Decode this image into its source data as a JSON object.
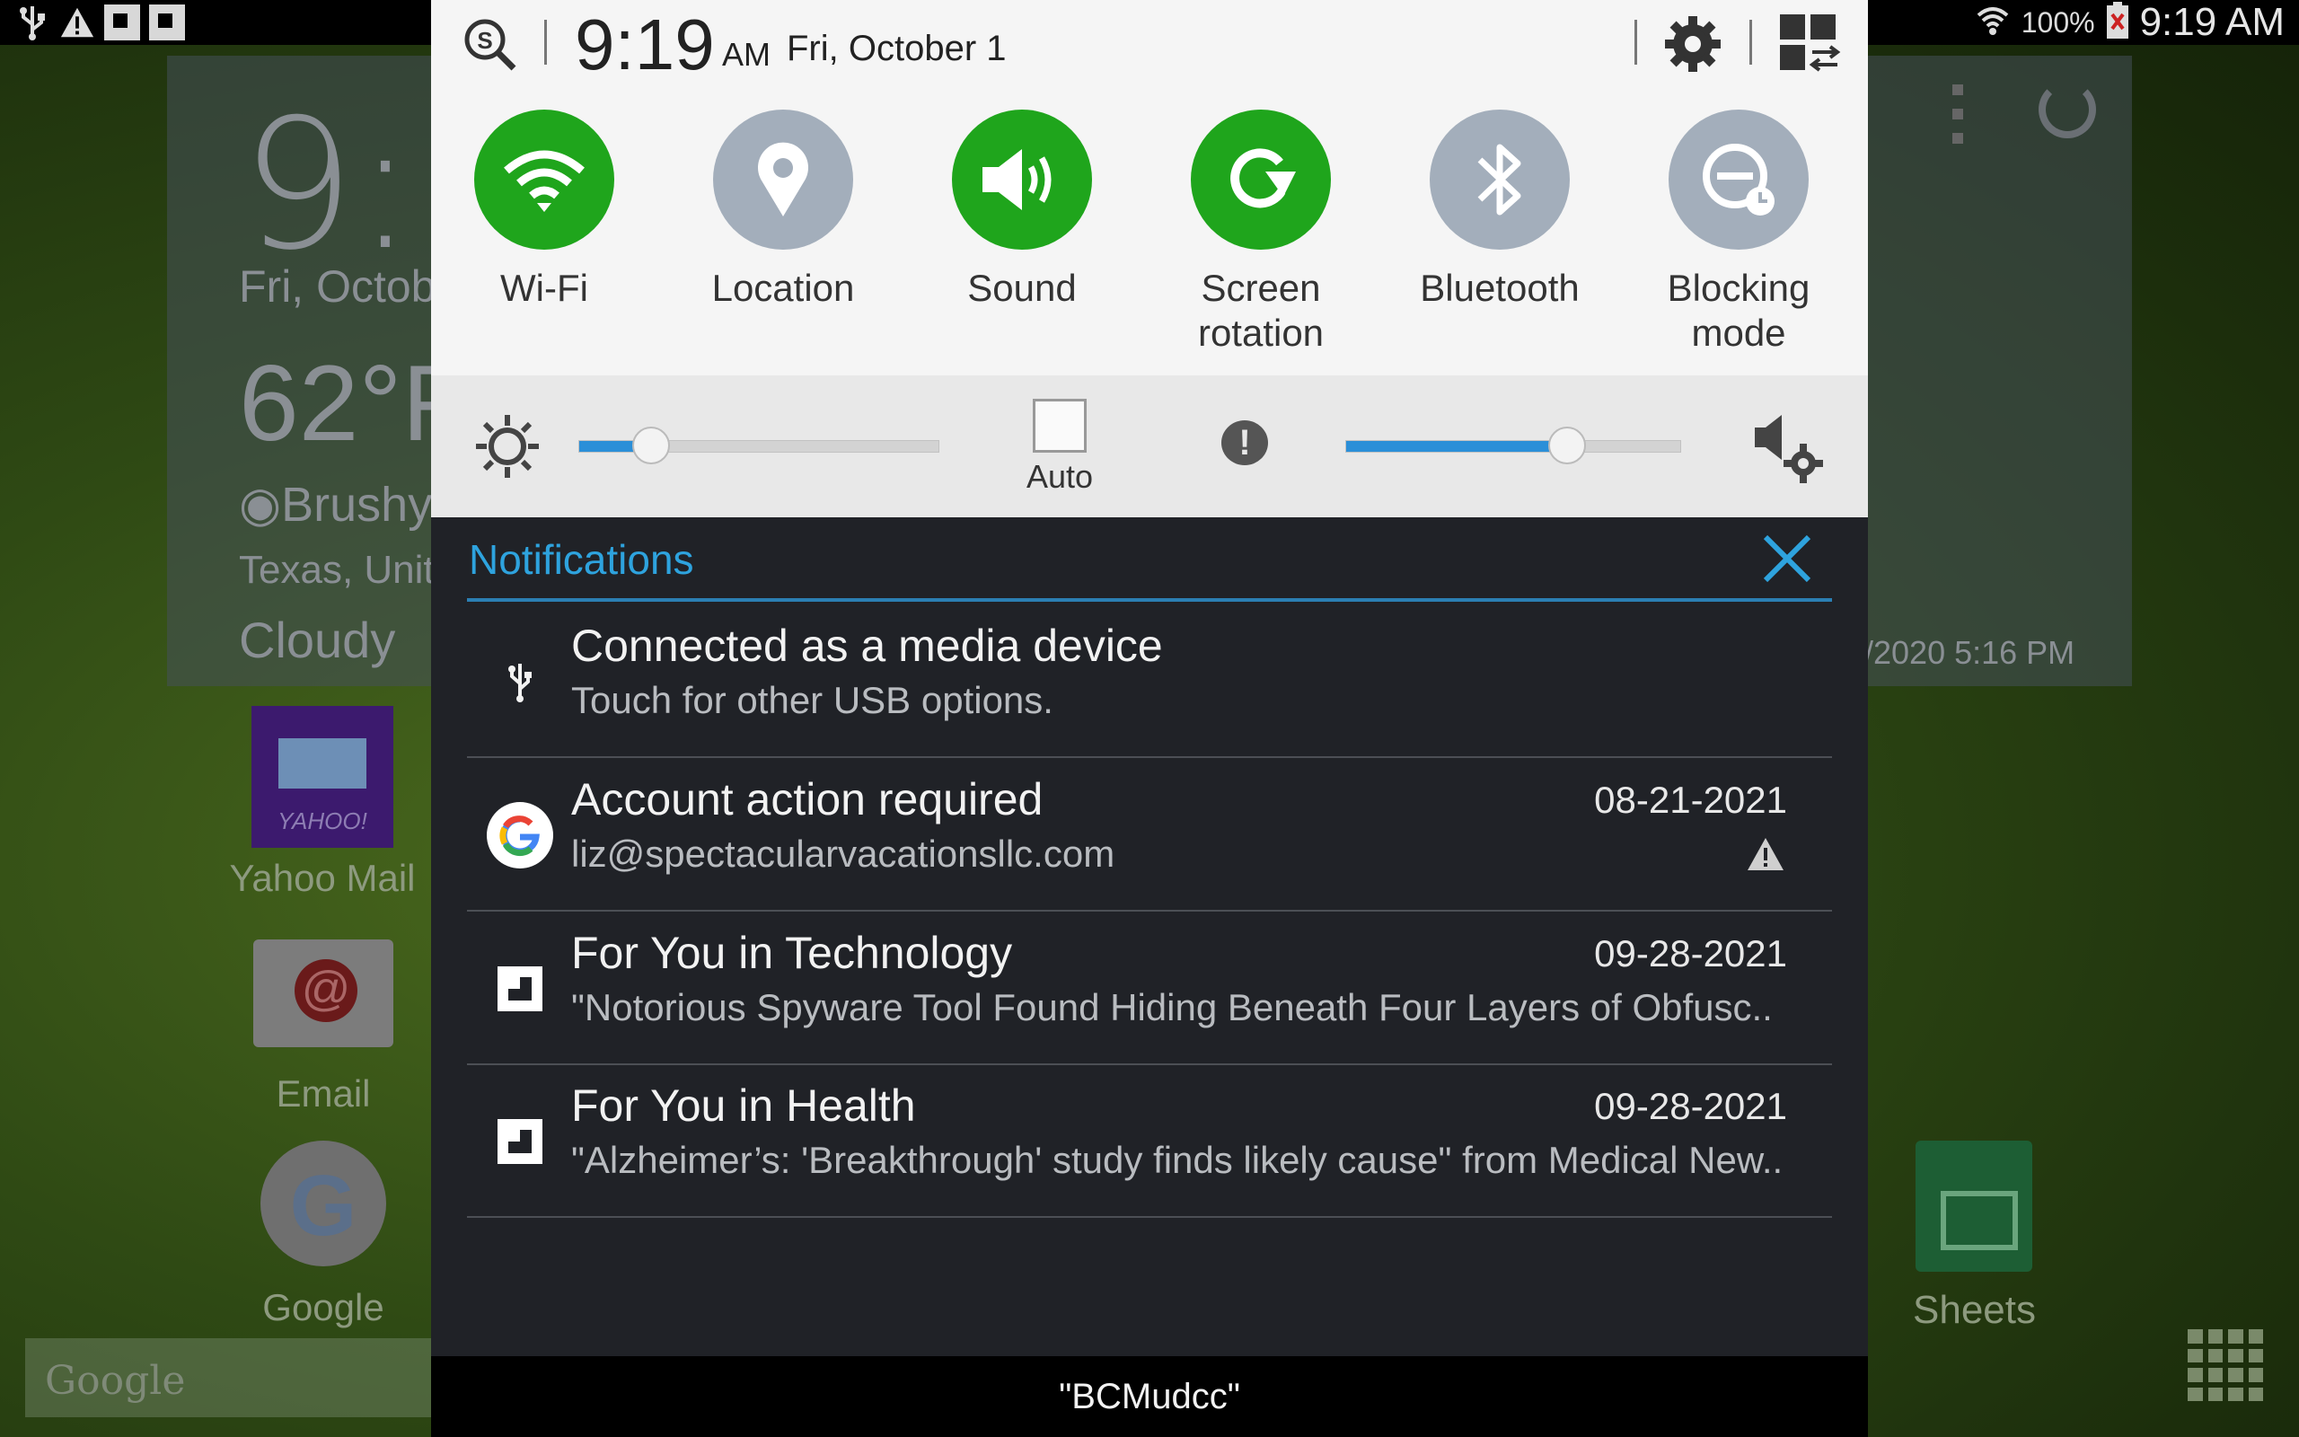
{
  "status_bar": {
    "battery_percent": "100%",
    "time": "9:19 AM",
    "left_icons": [
      "usb-icon",
      "warning-icon",
      "flipboard-icon",
      "flipboard-icon"
    ],
    "right_icons": [
      "wifi-icon",
      "battery-icon"
    ]
  },
  "home": {
    "clock_partial": "9:1",
    "date_partial": "Fri, Octobe",
    "temp_partial": "62°F",
    "location_partial": "Brushy",
    "region_partial": "Texas, Unit",
    "condition": "Cloudy",
    "updated_partial": "/2020 5:16 PM",
    "apps": [
      {
        "label": "Yahoo Mail",
        "icon": "yahoo-mail-icon",
        "icon_text": "YAHOO!"
      },
      {
        "label": "Email",
        "icon": "email-icon"
      },
      {
        "label": "Google",
        "icon": "google-icon"
      },
      {
        "label": "Sheets",
        "icon": "sheets-icon"
      }
    ],
    "search_placeholder": "Google"
  },
  "quick_settings": {
    "time": "9:19",
    "ampm": "AM",
    "date": "Fri, October 1",
    "toggles": [
      {
        "label": "Wi-Fi",
        "state": "on",
        "icon": "wifi-icon"
      },
      {
        "label": "Location",
        "state": "off",
        "icon": "location-pin-icon"
      },
      {
        "label": "Sound",
        "state": "on",
        "icon": "speaker-icon"
      },
      {
        "label": "Screen rotation",
        "state": "on",
        "icon": "rotation-icon"
      },
      {
        "label": "Bluetooth",
        "state": "off",
        "icon": "bluetooth-icon"
      },
      {
        "label": "Blocking mode",
        "state": "off",
        "icon": "blocking-mode-icon"
      }
    ],
    "brightness_level": 0.2,
    "auto_label": "Auto",
    "volume_level": 0.66,
    "colors": {
      "on": "#1fa51c",
      "off": "#a3aebb",
      "accent": "#2b8fd8"
    }
  },
  "notifications": {
    "header": "Notifications",
    "items": [
      {
        "title": "Connected as a media device",
        "subtitle": "Touch for other USB options.",
        "date": "",
        "icon": "usb-icon"
      },
      {
        "title": "Account action required",
        "subtitle": "liz@spectacularvacationsllc.com",
        "date": "08-21-2021",
        "icon": "google-g-icon"
      },
      {
        "title": "For You in Technology",
        "subtitle": "\"Notorious Spyware Tool Found Hiding Beneath Four Layers of Obfusc..",
        "date": "09-28-2021",
        "icon": "flipboard-icon"
      },
      {
        "title": "For You in Health",
        "subtitle": "\"Alzheimer’s: 'Breakthrough' study finds likely cause\" from Medical New..",
        "date": "09-28-2021",
        "icon": "flipboard-icon"
      }
    ]
  },
  "footer": {
    "network": "\"BCMudcc\""
  }
}
